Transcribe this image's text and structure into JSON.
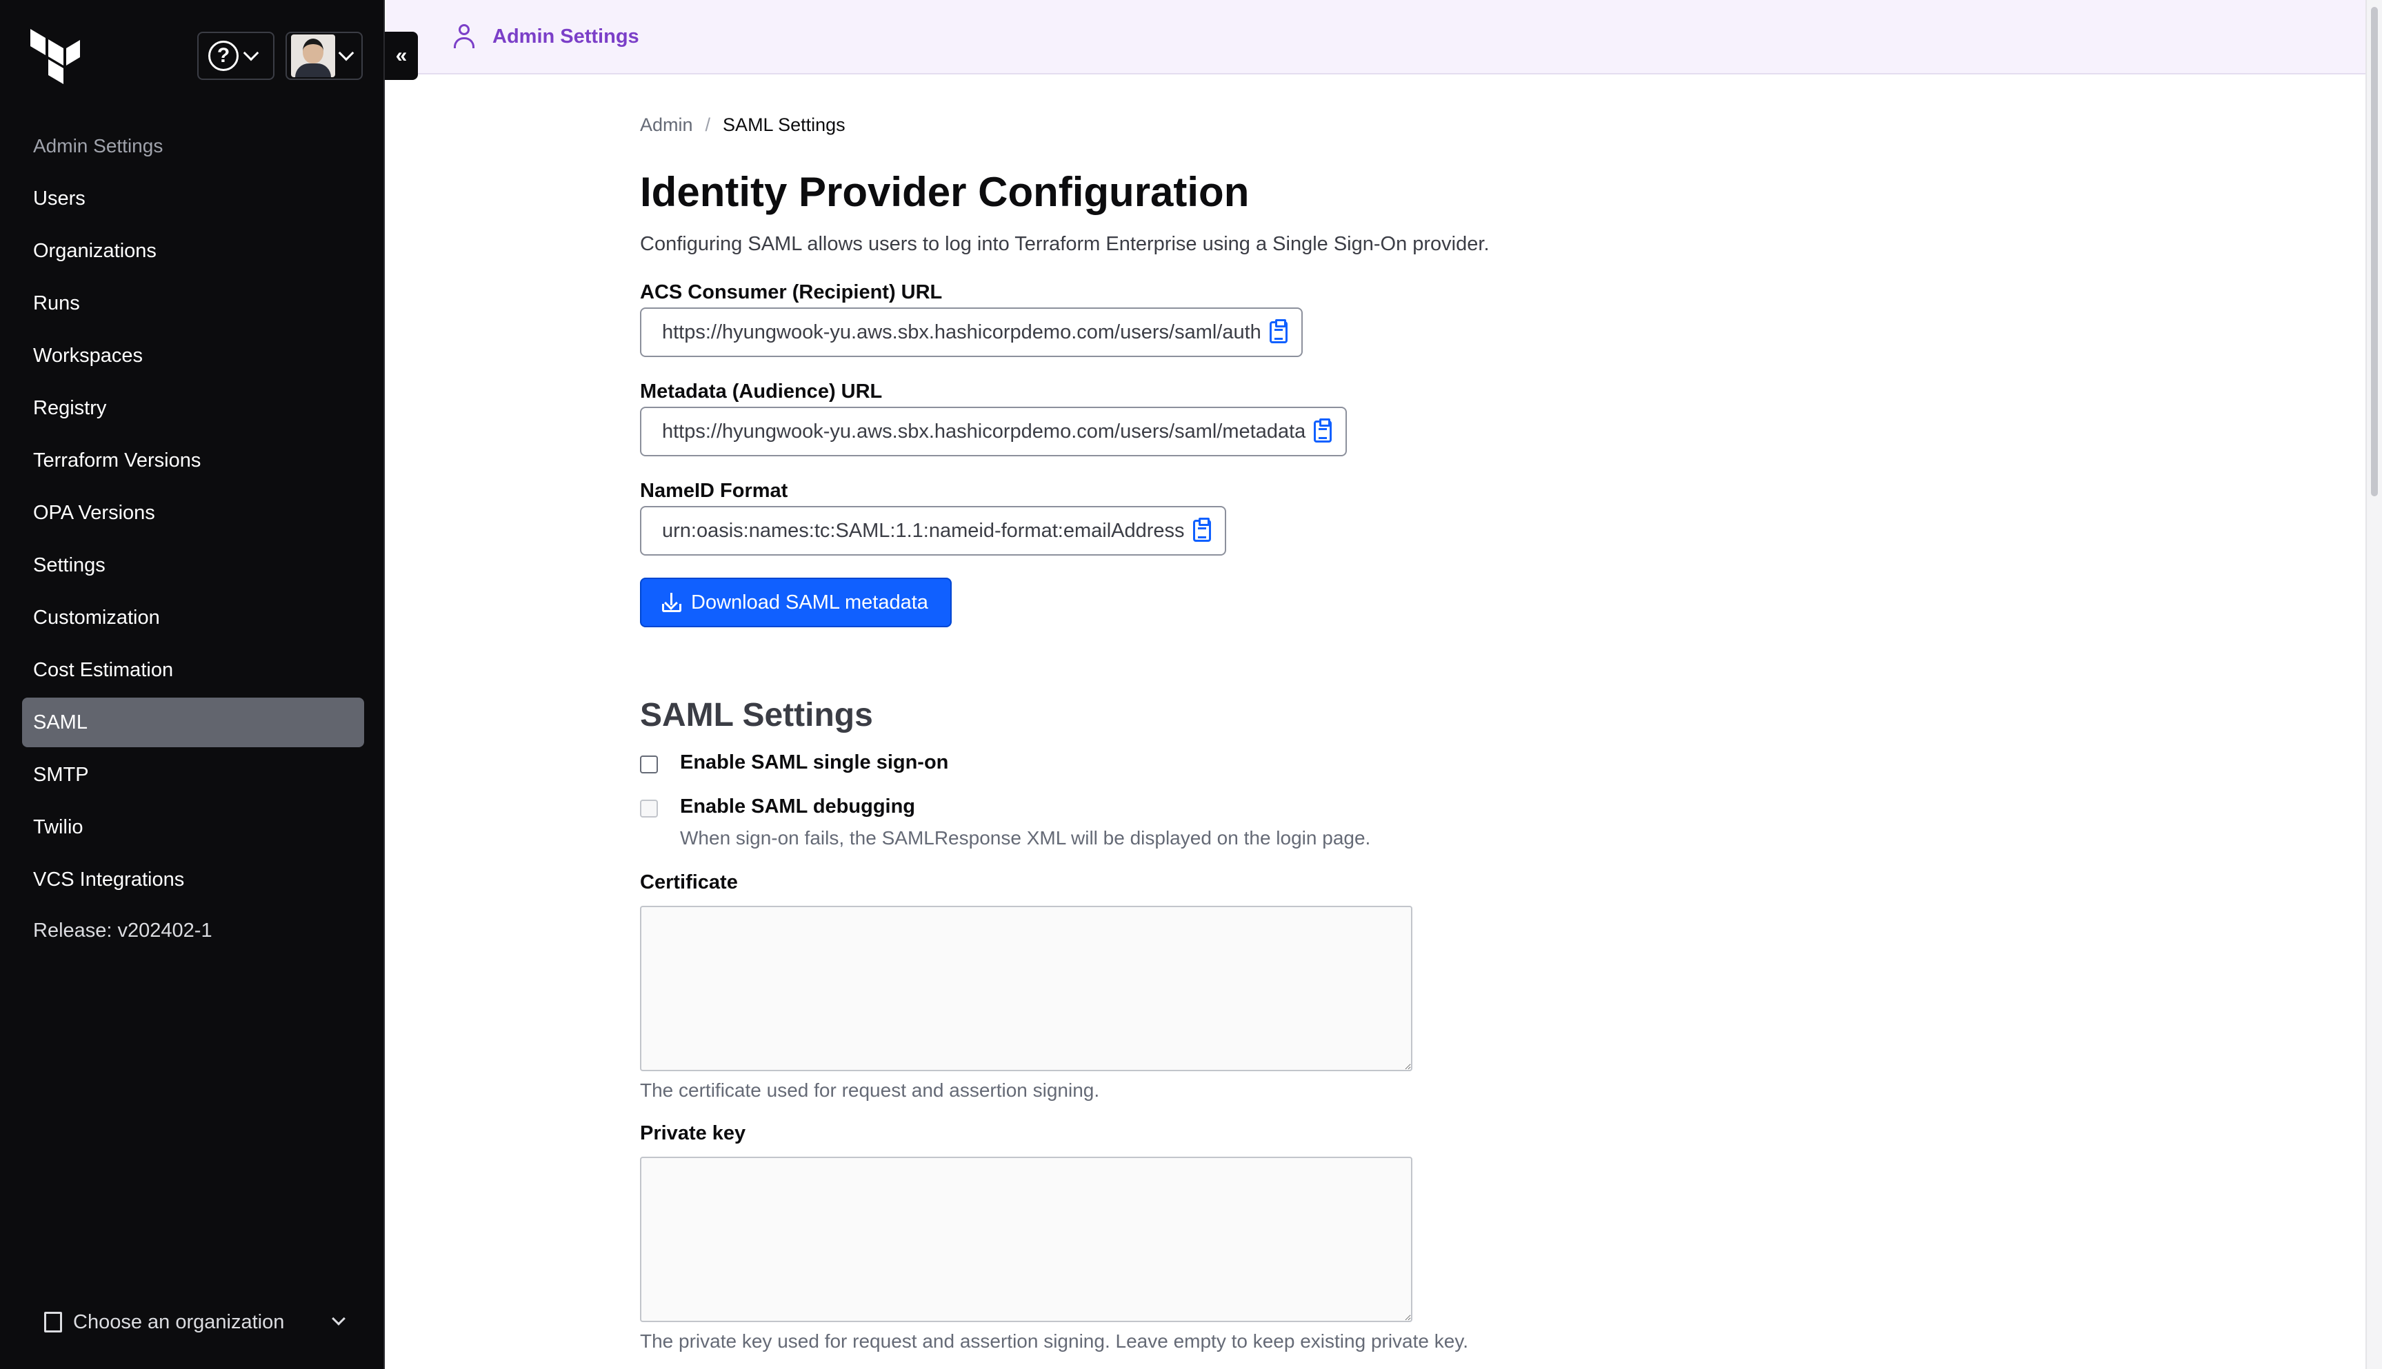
{
  "sidebar": {
    "section_title": "Admin Settings",
    "items": [
      {
        "label": "Users"
      },
      {
        "label": "Organizations"
      },
      {
        "label": "Runs"
      },
      {
        "label": "Workspaces"
      },
      {
        "label": "Registry"
      },
      {
        "label": "Terraform Versions"
      },
      {
        "label": "OPA Versions"
      },
      {
        "label": "Settings"
      },
      {
        "label": "Customization"
      },
      {
        "label": "Cost Estimation"
      },
      {
        "label": "SAML",
        "active": true
      },
      {
        "label": "SMTP"
      },
      {
        "label": "Twilio"
      },
      {
        "label": "VCS Integrations"
      }
    ],
    "release": "Release: v202402-1",
    "org_chooser": "Choose an organization",
    "collapse_glyph": "«",
    "help_glyph": "?"
  },
  "topbar": {
    "title": "Admin Settings",
    "icon": "person-icon"
  },
  "breadcrumb": {
    "parent": "Admin",
    "separator": "/",
    "current": "SAML Settings"
  },
  "page": {
    "title": "Identity Provider Configuration",
    "description": "Configuring SAML allows users to log into Terraform Enterprise using a Single Sign-On provider."
  },
  "fields": {
    "acs": {
      "label": "ACS Consumer (Recipient) URL",
      "value": "https://hyungwook-yu.aws.sbx.hashicorpdemo.com/users/saml/auth"
    },
    "metadata": {
      "label": "Metadata (Audience) URL",
      "value": "https://hyungwook-yu.aws.sbx.hashicorpdemo.com/users/saml/metadata"
    },
    "nameid": {
      "label": "NameID Format",
      "value": "urn:oasis:names:tc:SAML:1.1:nameid-format:emailAddress"
    }
  },
  "download_button": "Download SAML metadata",
  "saml_settings": {
    "title": "SAML Settings",
    "enable_sso": {
      "label": "Enable SAML single sign-on",
      "checked": false
    },
    "enable_debug": {
      "label": "Enable SAML debugging",
      "checked": false,
      "disabled": true,
      "help": "When sign-on fails, the SAMLResponse XML will be displayed on the login page."
    },
    "certificate": {
      "label": "Certificate",
      "value": "",
      "help": "The certificate used for request and assertion signing."
    },
    "private_key": {
      "label": "Private key",
      "value": "",
      "help": "The private key used for request and assertion signing. Leave empty to keep existing private key."
    }
  },
  "colors": {
    "sidebar_bg": "#0c0c0e",
    "accent_purple": "#7b3fc8",
    "primary_blue": "#1060ff",
    "active_nav": "#62656e"
  }
}
